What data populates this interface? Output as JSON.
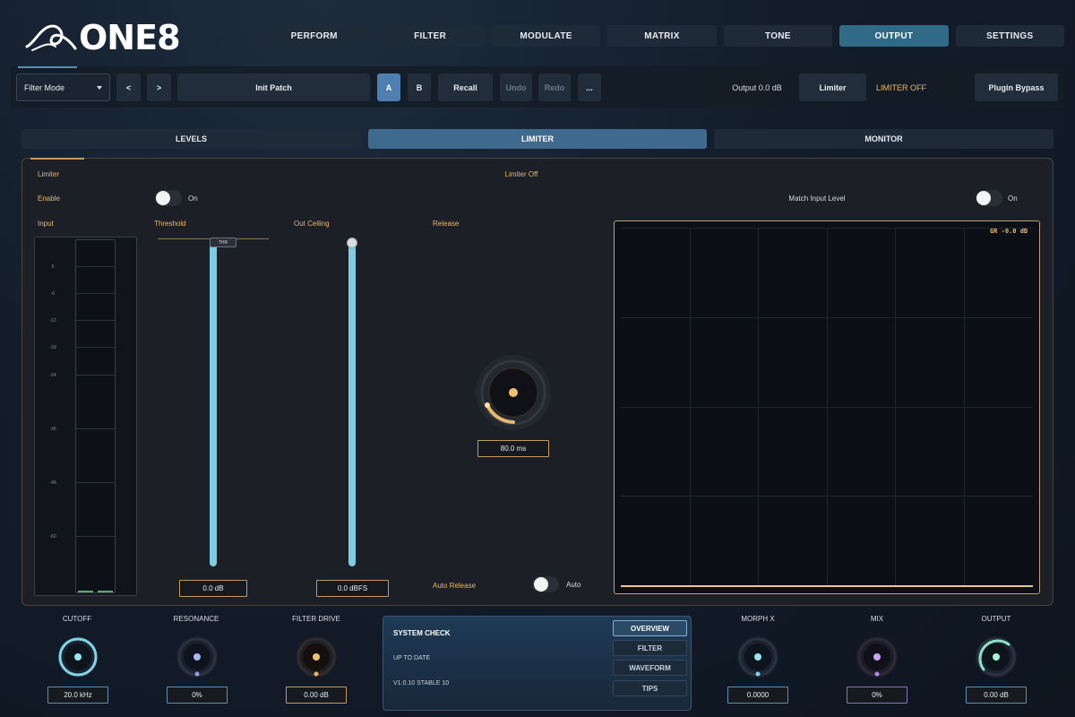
{
  "app": {
    "logo_text": "ONE8"
  },
  "main_tabs": [
    {
      "label": "PERFORM"
    },
    {
      "label": "FILTER"
    },
    {
      "label": "MODULATE"
    },
    {
      "label": "MATRIX"
    },
    {
      "label": "TONE"
    },
    {
      "label": "OUTPUT",
      "active": true
    },
    {
      "label": "SETTINGS"
    }
  ],
  "toolbar": {
    "filter_mode": "Filter Mode",
    "prev_label": "<",
    "next_label": ">",
    "patch_name": "Init Patch",
    "a_label": "A",
    "b_label": "B",
    "recall_label": "Recall",
    "undo_label": "Undo",
    "redo_label": "Redo",
    "more_label": "...",
    "output_readout": "Output 0.0 dB",
    "limiter_label": "Limiter",
    "limiter_state": "LIMITER OFF",
    "bypass_label": "Plugin Bypass"
  },
  "sub_tabs": [
    {
      "label": "LEVELS"
    },
    {
      "label": "LIMITER",
      "active": true
    },
    {
      "label": "MONITOR"
    }
  ],
  "limiter": {
    "section_label": "Limiter",
    "status": "Limiter Off",
    "enable_label": "Enable",
    "enable_state": "On",
    "match_label": "Match Input Level",
    "match_state": "On",
    "input_label": "Input",
    "threshold_label": "Threshold",
    "ceiling_label": "Out Ceiling",
    "release_label": "Release",
    "meter_ticks": [
      "0",
      "-6",
      "-12",
      "-18",
      "-24",
      "-36",
      "-48",
      "-60"
    ],
    "thr_handle": "THR",
    "threshold_value": "0.0 dB",
    "ceiling_value": "0.0 dBFS",
    "release_value": "80.0 ms",
    "auto_release_label": "Auto Release",
    "auto_state": "Auto",
    "gr_readout": "GR -0.0 dB"
  },
  "macros": [
    {
      "label": "CUTOFF",
      "value": "20.0 kHz",
      "color": "#7fd6e6"
    },
    {
      "label": "RESONANCE",
      "value": "0%",
      "color": "#8aa0e8"
    },
    {
      "label": "FILTER DRIVE",
      "value": "0.00 dB",
      "color": "#e8b86e"
    },
    {
      "label": "MORPH X",
      "value": "0.0000",
      "color": "#7fd6e6"
    },
    {
      "label": "MIX",
      "value": "0%",
      "color": "#b58ae8"
    },
    {
      "label": "OUTPUT",
      "value": "0.00 dB",
      "color": "#8fe0c8"
    }
  ],
  "system_check": {
    "title": "SYSTEM CHECK",
    "status": "UP TO DATE",
    "version": "V1.0.10 STABLE 10",
    "buttons": [
      {
        "label": "OVERVIEW",
        "active": true
      },
      {
        "label": "FILTER"
      },
      {
        "label": "WAVEFORM"
      },
      {
        "label": "TIPS"
      }
    ]
  }
}
